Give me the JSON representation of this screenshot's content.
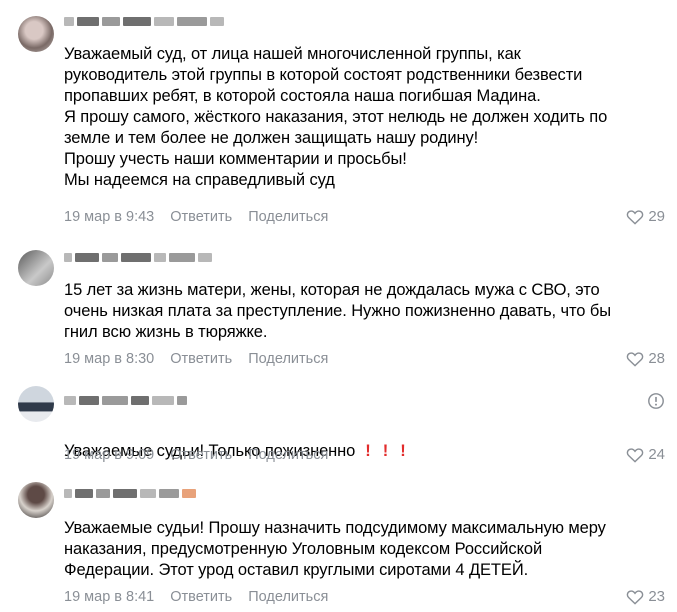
{
  "comments": [
    {
      "text": "Уважаемый суд, от лица нашей многочисленной группы, как\nруководитель этой группы в которой состоят родственники безвести\nпропавших ребят, в которой состояла наша погибшая Мадина.\nЯ прошу самого, жёсткого наказания, этот нелюдь не должен ходить по\nземле и тем более не должен защищать нашу родину!\nПрошу учесть наши комментарии и просьбы!\nМы надеемся на справедливый суд",
      "date": "19 мар в 9:43",
      "reply": "Ответить",
      "share": "Поделиться",
      "likes": "29"
    },
    {
      "text": "15 лет за жизнь матери, жены, которая не дождалась мужа с СВО, это\nочень низкая плата за преступление. Нужно пожизненно давать, что бы\nгнил всю жизнь в тюряжке.",
      "date": "19 мар в 8:30",
      "reply": "Ответить",
      "share": "Поделиться",
      "likes": "28"
    },
    {
      "text": "Уважаемые судьи! Только пожизненно",
      "emphasis": "!!!",
      "date": "19 мар в 9:09",
      "reply": "Ответить",
      "share": "Поделиться",
      "likes": "24"
    },
    {
      "text": "Уважаемые судьи! Прошу назначить подсудимому максимальную меру\nнаказания, предусмотренную Уголовным кодексом Российской\nФедерации. Этот урод оставил круглыми сиротами 4 ДЕТЕЙ.",
      "date": "19 мар в 8:41",
      "reply": "Ответить",
      "share": "Поделиться",
      "likes": "23"
    }
  ],
  "colors": {
    "meta": "#8a8f96",
    "emphasis": "#e22c2c",
    "text": "#000000"
  },
  "icons": {
    "like": "heart-icon",
    "more": "info-circle-icon"
  }
}
